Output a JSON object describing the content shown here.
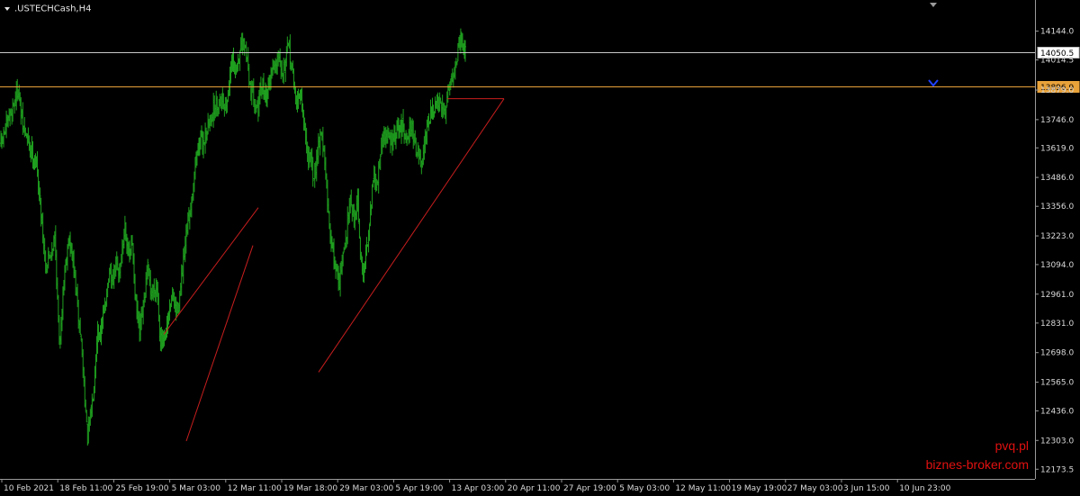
{
  "window": {
    "symbol_label": ".USTECHCash,H4",
    "menu_icon": "triangle-down-icon"
  },
  "watermark": {
    "line1": "pvq.pl",
    "line2": "biznes-broker.com"
  },
  "colors": {
    "background": "#000000",
    "candle": "#1fa01f",
    "trendline": "#c81e1e",
    "price_line": "#c8c8c8",
    "level_line": "#e8a23a",
    "axis_text": "#d8d8d8",
    "marker": "#2040ff",
    "watermark": "#e01010"
  },
  "chart_data": {
    "type": "candlestick",
    "title": ".USTECHCash,H4",
    "ylim": [
      12130,
      14280
    ],
    "y_ticks": [
      "14144.0",
      "14014.5",
      "13879.0",
      "13746.0",
      "13619.0",
      "13486.0",
      "13356.0",
      "13223.0",
      "13094.0",
      "12961.0",
      "12831.0",
      "12698.0",
      "12565.0",
      "12436.0",
      "12303.0",
      "12173.5"
    ],
    "x_ticks": [
      "10 Feb 2021",
      "18 Feb 11:00",
      "25 Feb 19:00",
      "5 Mar 03:00",
      "12 Mar 11:00",
      "19 Mar 18:00",
      "29 Mar 03:00",
      "5 Apr 19:00",
      "13 Apr 03:00",
      "20 Apr 11:00",
      "27 Apr 19:00",
      "5 May 03:00",
      "12 May 11:00",
      "19 May 19:00",
      "27 May 03:00",
      "3 Jun 15:00",
      "10 Jun 23:00"
    ],
    "bar_count": 510,
    "anchors": [
      [
        0,
        13640
      ],
      [
        20,
        13760
      ],
      [
        38,
        13890
      ],
      [
        48,
        13720
      ],
      [
        62,
        13640
      ],
      [
        78,
        13560
      ],
      [
        88,
        13360
      ],
      [
        100,
        13080
      ],
      [
        112,
        13160
      ],
      [
        120,
        13220
      ],
      [
        130,
        12720
      ],
      [
        140,
        13040
      ],
      [
        150,
        13210
      ],
      [
        160,
        13120
      ],
      [
        170,
        12900
      ],
      [
        178,
        12760
      ],
      [
        186,
        12520
      ],
      [
        192,
        12300
      ],
      [
        200,
        12430
      ],
      [
        207,
        12560
      ],
      [
        214,
        12800
      ],
      [
        222,
        12780
      ],
      [
        230,
        12900
      ],
      [
        240,
        13040
      ],
      [
        248,
        13010
      ],
      [
        255,
        13100
      ],
      [
        262,
        13050
      ],
      [
        270,
        13160
      ],
      [
        276,
        13280
      ],
      [
        284,
        13120
      ],
      [
        292,
        13180
      ],
      [
        300,
        12920
      ],
      [
        308,
        12780
      ],
      [
        318,
        12920
      ],
      [
        326,
        13080
      ],
      [
        334,
        12960
      ],
      [
        346,
        13020
      ],
      [
        354,
        12760
      ],
      [
        362,
        12730
      ],
      [
        372,
        12840
      ],
      [
        380,
        12960
      ],
      [
        390,
        12880
      ],
      [
        398,
        12960
      ],
      [
        406,
        13100
      ],
      [
        414,
        13260
      ],
      [
        424,
        13400
      ],
      [
        432,
        13560
      ],
      [
        440,
        13640
      ],
      [
        450,
        13650
      ],
      [
        460,
        13710
      ],
      [
        470,
        13780
      ],
      [
        480,
        13820
      ],
      [
        492,
        13840
      ],
      [
        502,
        13810
      ],
      [
        506,
        13900
      ],
      [
        514,
        14010
      ],
      [
        522,
        13960
      ],
      [
        530,
        14040
      ],
      [
        538,
        14080
      ],
      [
        546,
        14050
      ],
      [
        554,
        13890
      ],
      [
        562,
        13860
      ],
      [
        570,
        13790
      ],
      [
        580,
        13900
      ],
      [
        590,
        13850
      ],
      [
        600,
        13960
      ],
      [
        610,
        14000
      ],
      [
        618,
        14060
      ],
      [
        626,
        13960
      ],
      [
        634,
        14020
      ],
      [
        640,
        14080
      ],
      [
        648,
        13950
      ],
      [
        656,
        13820
      ],
      [
        664,
        13860
      ],
      [
        672,
        13760
      ],
      [
        680,
        13600
      ],
      [
        688,
        13560
      ],
      [
        696,
        13480
      ],
      [
        704,
        13620
      ],
      [
        712,
        13700
      ],
      [
        720,
        13540
      ],
      [
        728,
        13300
      ],
      [
        736,
        13180
      ],
      [
        744,
        13080
      ],
      [
        752,
        13020
      ],
      [
        760,
        13120
      ],
      [
        768,
        13230
      ],
      [
        776,
        13420
      ],
      [
        784,
        13290
      ],
      [
        792,
        13400
      ],
      [
        800,
        13110
      ],
      [
        806,
        13040
      ],
      [
        812,
        13150
      ],
      [
        820,
        13320
      ],
      [
        828,
        13480
      ],
      [
        836,
        13440
      ],
      [
        844,
        13620
      ],
      [
        852,
        13680
      ],
      [
        862,
        13660
      ],
      [
        872,
        13650
      ],
      [
        882,
        13700
      ],
      [
        892,
        13710
      ],
      [
        902,
        13680
      ],
      [
        912,
        13720
      ],
      [
        920,
        13640
      ],
      [
        928,
        13580
      ],
      [
        936,
        13520
      ],
      [
        944,
        13660
      ],
      [
        952,
        13760
      ],
      [
        960,
        13780
      ],
      [
        970,
        13820
      ],
      [
        980,
        13790
      ],
      [
        988,
        13790
      ],
      [
        994,
        13900
      ],
      [
        1002,
        13940
      ],
      [
        1010,
        13980
      ],
      [
        1018,
        14100
      ],
      [
        1024,
        14120
      ],
      [
        1032,
        14040
      ]
    ],
    "trendlines": [
      {
        "from": [
          "3 Mar",
          12780
        ],
        "to": [
          "15 Mar",
          13350
        ]
      },
      {
        "from": [
          "5 Mar",
          12300
        ],
        "to": [
          "16 Mar",
          13180
        ]
      },
      {
        "from": [
          "23 Mar",
          12610
        ],
        "to": [
          "20 Apr",
          13840
        ]
      },
      {
        "from": [
          "13 Apr",
          13840
        ],
        "to": [
          "20 Apr",
          13840
        ]
      }
    ],
    "price_lines": [
      {
        "value": "14050.5",
        "type": "current",
        "color": "#c8c8c8"
      },
      {
        "value": "13896.9",
        "type": "level",
        "color": "#e8a23a"
      }
    ]
  }
}
